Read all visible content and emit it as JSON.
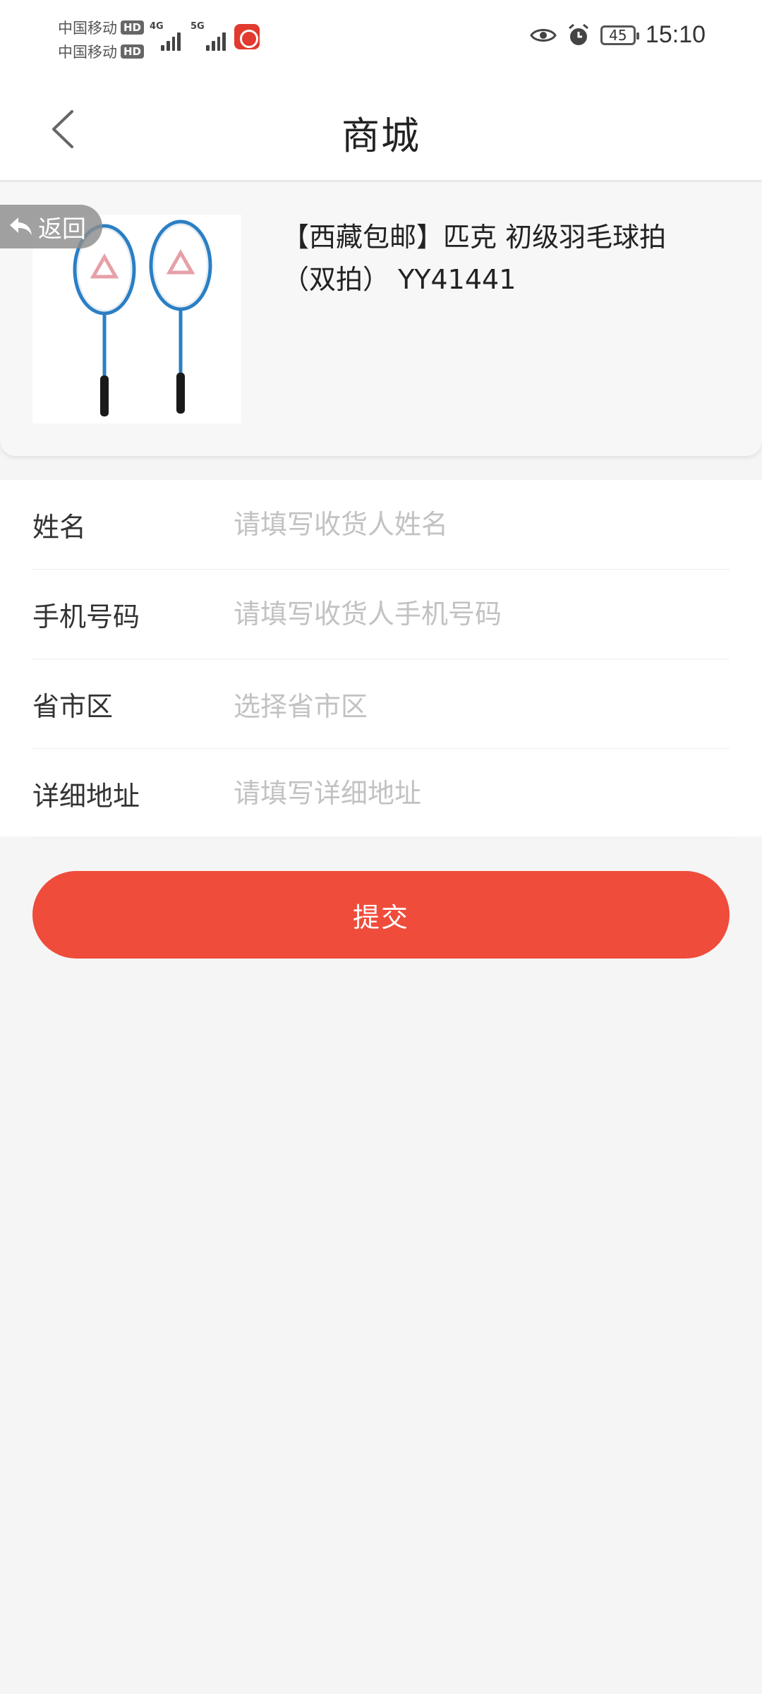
{
  "status_bar": {
    "carrier_1": "中国移动",
    "carrier_2": "中国移动",
    "hd_badge": "HD",
    "network_1": "4G",
    "network_2": "5G",
    "battery": "45",
    "time": "15:10",
    "icons": [
      "eye-icon",
      "alarm-icon",
      "fm-radio-icon",
      "signal-icon"
    ]
  },
  "header": {
    "title": "商城",
    "back_icon": "chevron-left-icon"
  },
  "product": {
    "name": "【西藏包邮】匹克 初级羽毛球拍（双拍） YY41441",
    "image_icon": "badminton-rackets-image"
  },
  "return_button": {
    "label": "返回",
    "icon": "reply-arrow-icon"
  },
  "form": {
    "name": {
      "label": "姓名",
      "placeholder": "请填写收货人姓名",
      "value": ""
    },
    "phone": {
      "label": "手机号码",
      "placeholder": "请填写收货人手机号码",
      "value": ""
    },
    "region": {
      "label": "省市区",
      "placeholder": "选择省市区",
      "value": ""
    },
    "address": {
      "label": "详细地址",
      "placeholder": "请填写详细地址",
      "value": ""
    }
  },
  "submit": {
    "label": "提交"
  },
  "colors": {
    "accent": "#ef4c3b",
    "background": "#f5f5f5",
    "placeholder": "#c2c2c2",
    "fm_icon": "#e23a2e"
  }
}
